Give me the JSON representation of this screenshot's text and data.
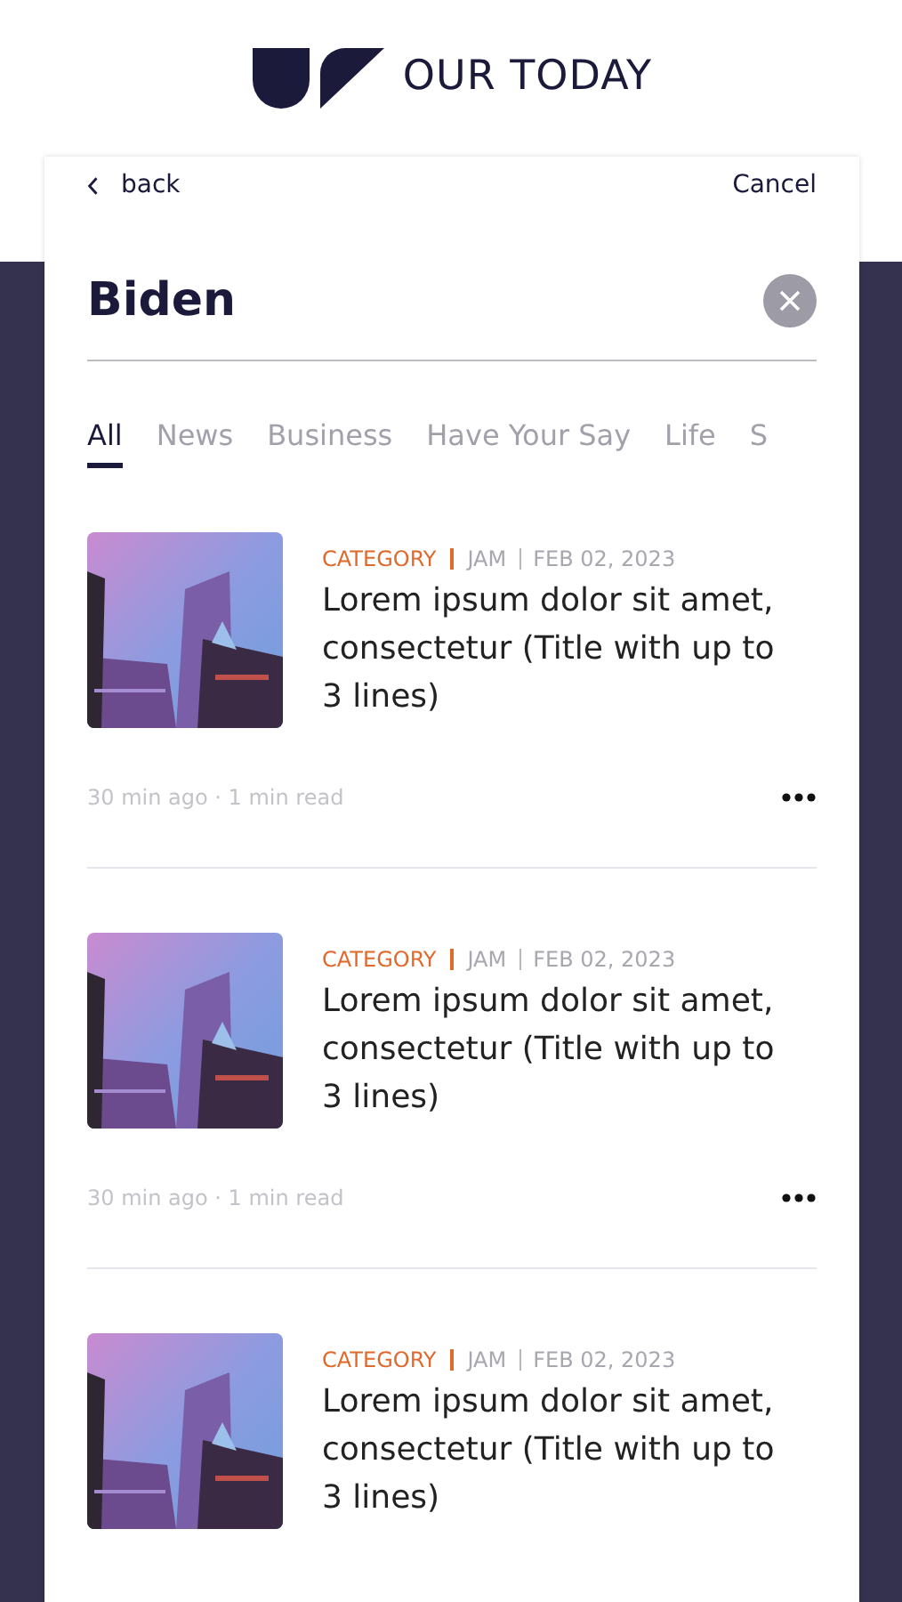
{
  "brand": {
    "name": "OUR TODAY"
  },
  "nav": {
    "back": "back",
    "cancel": "Cancel"
  },
  "search": {
    "value": "Biden"
  },
  "tabs": [
    {
      "label": "All",
      "selected": true
    },
    {
      "label": "News",
      "selected": false
    },
    {
      "label": "Business",
      "selected": false
    },
    {
      "label": "Have Your Say",
      "selected": false
    },
    {
      "label": "Life",
      "selected": false
    },
    {
      "label": "S",
      "selected": false
    }
  ],
  "articles": [
    {
      "category": "CATEGORY",
      "section": "JAM",
      "date": "FEB 02, 2023",
      "title": "Lorem ipsum dolor sit amet, consectetur (Title with up to 3 lines)",
      "meta": "30 min ago · 1 min read"
    },
    {
      "category": "CATEGORY",
      "section": "JAM",
      "date": "FEB 02, 2023",
      "title": "Lorem ipsum dolor sit amet, consectetur (Title with up to 3 lines)",
      "meta": "30 min ago · 1 min read"
    },
    {
      "category": "CATEGORY",
      "section": "JAM",
      "date": "FEB 02, 2023",
      "title": "Lorem ipsum dolor sit amet, consectetur (Title with up to 3 lines)"
    }
  ]
}
